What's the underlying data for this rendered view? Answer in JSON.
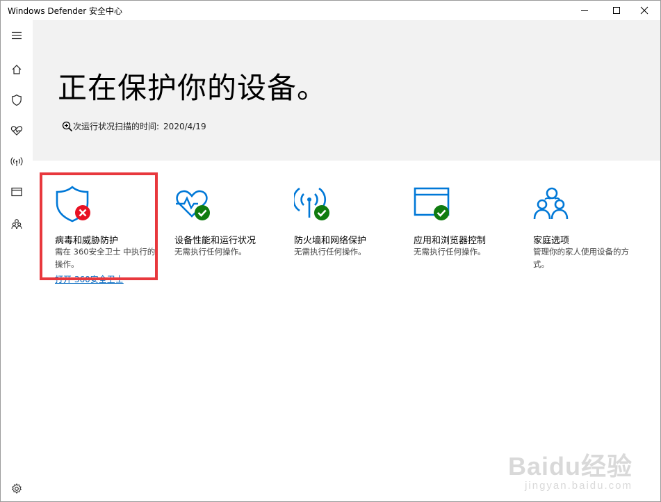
{
  "window": {
    "title": "Windows Defender 安全中心"
  },
  "titlebar_buttons": {
    "minimize_icon": "minimize-icon",
    "maximize_icon": "maximize-icon",
    "close_icon": "close-icon"
  },
  "sidebar": {
    "items": [
      {
        "icon": "hamburger-icon"
      },
      {
        "icon": "home-icon"
      },
      {
        "icon": "shield-icon"
      },
      {
        "icon": "heart-pulse-icon"
      },
      {
        "icon": "wireless-icon"
      },
      {
        "icon": "browser-window-icon"
      },
      {
        "icon": "family-icon"
      }
    ],
    "settings_icon": "gear-icon"
  },
  "hero": {
    "heading": "正在保护你的设备。",
    "scan_label": "次运行状况扫描的时间:",
    "scan_date": "2020/4/19"
  },
  "tiles": [
    {
      "title": "病毒和威胁防护",
      "desc": "需在 360安全卫士 中执行的操作。",
      "link": "打开 360安全卫士",
      "status": "error"
    },
    {
      "title": "设备性能和运行状况",
      "desc": "无需执行任何操作。",
      "status": "ok"
    },
    {
      "title": "防火墙和网络保护",
      "desc": "无需执行任何操作。",
      "status": "ok"
    },
    {
      "title": "应用和浏览器控制",
      "desc": "无需执行任何操作。",
      "status": "ok"
    },
    {
      "title": "家庭选项",
      "desc": "管理你的家人使用设备的方式。"
    }
  ],
  "colors": {
    "accent": "#0078d7",
    "ok": "#107c10",
    "error": "#e81123",
    "highlight": "#e8383d",
    "hero_bg": "#f2f2f2"
  },
  "watermark": {
    "main": "Baidu经验",
    "sub": "jingyan.baidu.com"
  }
}
